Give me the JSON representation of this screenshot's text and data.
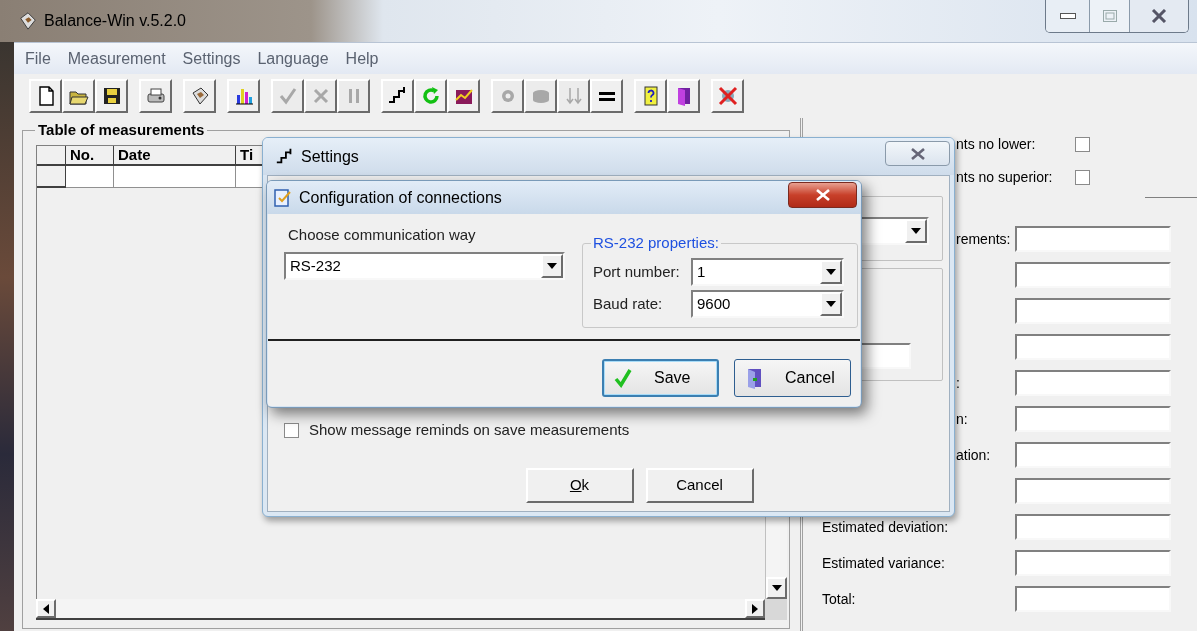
{
  "window": {
    "title": "Balance-Win v.5.2.0"
  },
  "menu": [
    "File",
    "Measurement",
    "Settings",
    "Language",
    "Help"
  ],
  "toolbar": [
    [
      {
        "kind": "new",
        "disabled": false
      },
      {
        "kind": "open",
        "disabled": false
      },
      {
        "kind": "save",
        "disabled": false
      }
    ],
    [
      {
        "kind": "print",
        "disabled": false
      }
    ],
    [
      {
        "kind": "scale",
        "disabled": false
      }
    ],
    [
      {
        "kind": "chart",
        "disabled": false
      }
    ],
    [
      {
        "kind": "accept",
        "disabled": true
      },
      {
        "kind": "reject",
        "disabled": true
      },
      {
        "kind": "pause",
        "disabled": true
      }
    ],
    [
      {
        "kind": "step",
        "disabled": false
      },
      {
        "kind": "refresh",
        "disabled": false
      },
      {
        "kind": "plot",
        "disabled": false
      }
    ],
    [
      {
        "kind": "transfer",
        "disabled": true
      },
      {
        "kind": "disk",
        "disabled": true
      },
      {
        "kind": "arrows",
        "disabled": true
      },
      {
        "kind": "equals",
        "disabled": false
      }
    ],
    [
      {
        "kind": "help",
        "disabled": false
      },
      {
        "kind": "exit",
        "disabled": false
      }
    ],
    [
      {
        "kind": "disconnect",
        "disabled": false
      }
    ]
  ],
  "table": {
    "title": "Table of measurements",
    "columns": [
      "No.",
      "Date",
      "Ti"
    ]
  },
  "statistics": {
    "options": [
      {
        "label": "nts no lower:",
        "checked": false
      },
      {
        "label": "nts no superior:",
        "checked": false
      }
    ],
    "fields": [
      {
        "kind": "cut",
        "label": "rements:"
      },
      {
        "kind": "blank"
      },
      {
        "kind": "blank"
      },
      {
        "kind": "blank"
      },
      {
        "kind": "cut",
        "label": ":"
      },
      {
        "kind": "cut",
        "label": "n:"
      },
      {
        "kind": "cut",
        "label": "ation:"
      },
      {
        "kind": "blank"
      },
      {
        "kind": "full",
        "label": "Estimated deviation:"
      },
      {
        "kind": "full",
        "label": "Estimated variance:"
      },
      {
        "kind": "full",
        "label": "Total:"
      }
    ]
  },
  "settings_dialog": {
    "title": "Settings",
    "reminder": {
      "label": "Show message reminds on save measurements",
      "checked": false
    },
    "buttons": [
      {
        "label": "Ok",
        "underline_first": true
      },
      {
        "label": "Cancel",
        "underline_first": false
      }
    ]
  },
  "connection_dialog": {
    "title": "Configuration of connections",
    "way": {
      "label": "Choose communication way",
      "value": "RS-232"
    },
    "properties": {
      "title": "RS-232 properties:",
      "fields": [
        {
          "label": "Port number:",
          "value": "1"
        },
        {
          "label": "Baud rate:",
          "value": "9600"
        }
      ]
    },
    "buttons": [
      {
        "kind": "save",
        "label": "Save",
        "focused": true
      },
      {
        "kind": "cancel",
        "label": "Cancel",
        "focused": false
      }
    ]
  }
}
